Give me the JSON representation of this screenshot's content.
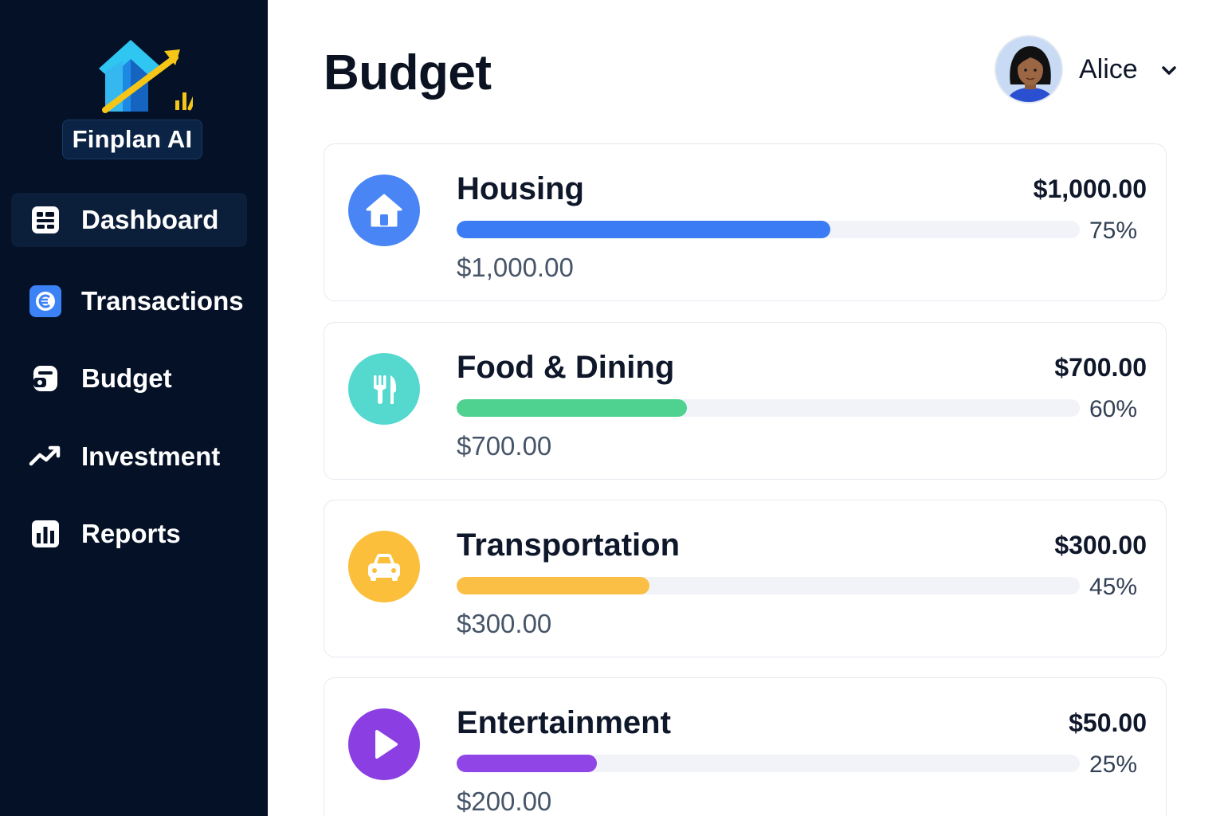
{
  "app": {
    "name": "Finplan AI"
  },
  "sidebar": {
    "items": [
      {
        "label": "Dashboard",
        "icon": "dashboard-icon",
        "active": true
      },
      {
        "label": "Transactions",
        "icon": "transactions-icon",
        "active": false
      },
      {
        "label": "Budget",
        "icon": "budget-icon",
        "active": false
      },
      {
        "label": "Investment",
        "icon": "trending-up-icon",
        "active": false
      },
      {
        "label": "Reports",
        "icon": "bar-chart-icon",
        "active": false
      }
    ]
  },
  "header": {
    "title": "Budget",
    "user": {
      "name": "Alice"
    }
  },
  "budgets": [
    {
      "name": "Housing",
      "amount": "$1,000.00",
      "percent_label": "75%",
      "progress": 0.6,
      "spent": "$1,000.00",
      "icon": "home-icon",
      "color": "#3b7cf4",
      "icon_bg": "#4a85f5"
    },
    {
      "name": "Food & Dining",
      "amount": "$700.00",
      "percent_label": "60%",
      "progress": 0.37,
      "spent": "$700.00",
      "icon": "fork-knife-icon",
      "color": "#4fd28f",
      "icon_bg": "#55d9cf"
    },
    {
      "name": "Transportation",
      "amount": "$300.00",
      "percent_label": "45%",
      "progress": 0.31,
      "spent": "$300.00",
      "icon": "car-icon",
      "color": "#fbbf45",
      "icon_bg": "#fbbf3c"
    },
    {
      "name": "Entertainment",
      "amount": "$50.00",
      "percent_label": "25%",
      "progress": 0.225,
      "spent": "$200.00",
      "icon": "play-icon",
      "color": "#9045e6",
      "icon_bg": "#8b3fe3"
    }
  ]
}
